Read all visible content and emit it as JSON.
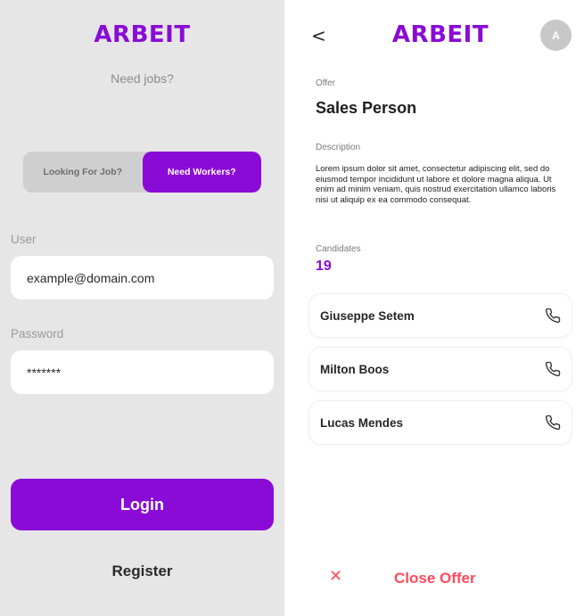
{
  "login_screen": {
    "brand": "ARBEIT",
    "tagline": "Need jobs?",
    "toggle": {
      "option_left": "Looking For Job?",
      "option_right": "Need Workers?",
      "selected": "Need Workers?"
    },
    "user": {
      "label": "User",
      "value": "example@domain.com"
    },
    "password": {
      "label": "Password",
      "value": "*******"
    },
    "login_label": "Login",
    "register_label": "Register"
  },
  "offer_screen": {
    "back_glyph": "<",
    "brand": "ARBEIT",
    "avatar_initial": "A",
    "offer_label": "Offer",
    "offer_title": "Sales Person",
    "description_label": "Description",
    "description": "Lorem ipsum dolor sit amet, consectetur adipiscing elit, sed do eiusmod tempor incididunt ut labore et dolore magna aliqua. Ut enim ad minim veniam, quis nostrud exercitation ullamco laboris nisi ut aliquip ex ea commodo consequat.",
    "candidates_label": "Candidates",
    "candidates_count": "19",
    "candidates": [
      {
        "name": "Giuseppe Setem",
        "icon": "phone-icon"
      },
      {
        "name": "Milton Boos",
        "icon": "phone-icon"
      },
      {
        "name": "Lucas Mendes",
        "icon": "phone-icon"
      }
    ],
    "close_glyph": "✕",
    "close_label": "Close Offer"
  },
  "colors": {
    "brand": "#8a0bd6",
    "danger": "#ff4b5c",
    "left_bg": "#e6e6e6",
    "muted": "#8c8c8c"
  }
}
